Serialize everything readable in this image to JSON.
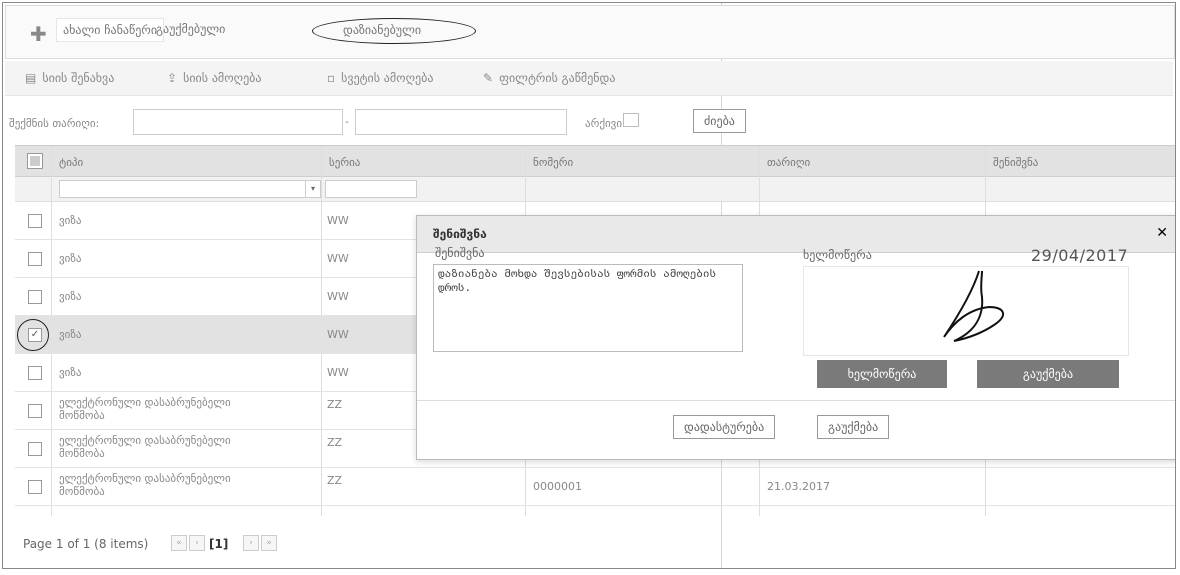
{
  "top_tabs": {
    "new_record": "ახალი ჩანაწერი",
    "cancelled": "გაუქმებული",
    "archived": "დაზიანებული"
  },
  "toolbar": {
    "list_view": "სიის შენახვა",
    "list_export": "სიის ამოღება",
    "column_select": "სვეტის ამოღება",
    "filter_clear": "ფილტრის გაწმენდა"
  },
  "filter": {
    "label": "შექმნის თარიღი:",
    "date_from": "",
    "date_to": "",
    "archive_label": "არქივი:",
    "search_button": "ძიება"
  },
  "grid": {
    "headers": [
      "ტიპი",
      "სერია",
      "ნომერი",
      "თარიღი",
      "შენიშვნა"
    ],
    "rows": [
      {
        "type": "ვიზა",
        "series": "WW",
        "number": "",
        "date": "",
        "checked": false
      },
      {
        "type": "ვიზა",
        "series": "WW",
        "number": "",
        "date": "",
        "checked": false
      },
      {
        "type": "ვიზა",
        "series": "WW",
        "number": "",
        "date": "",
        "checked": false
      },
      {
        "type": "ვიზა",
        "series": "WW",
        "number": "",
        "date": "",
        "checked": true
      },
      {
        "type": "ვიზა",
        "series": "WW",
        "number": "",
        "date": "",
        "checked": false
      },
      {
        "type": "ელექტრონული დასაბრუნებელი მოწმობა",
        "series": "ZZ",
        "number": "",
        "date": "",
        "checked": false
      },
      {
        "type": "ელექტრონული დასაბრუნებელი მოწმობა",
        "series": "ZZ",
        "number": "",
        "date": "",
        "checked": false
      },
      {
        "type": "ელექტრონული დასაბრუნებელი მოწმობა",
        "series": "ZZ",
        "number": "0000001",
        "date": "21.03.2017",
        "checked": false
      }
    ]
  },
  "pager": {
    "summary": "Page 1 of 1 (8 items)",
    "current_page": "[1]"
  },
  "dialog": {
    "title": "შენიშვნა",
    "note_label": "შენიშვნა",
    "note_text": "დაზიანება მოხდა შევსებისას ფორმის ამოღების დროს.",
    "signature_label": "ხელმოწერა",
    "date": "29/04/2017",
    "sign_button": "ხელმოწერა",
    "clear_button": "გაუქმება",
    "confirm_button": "დადასტურება",
    "cancel_button": "გაუქმება",
    "close_icon": "close-icon"
  }
}
